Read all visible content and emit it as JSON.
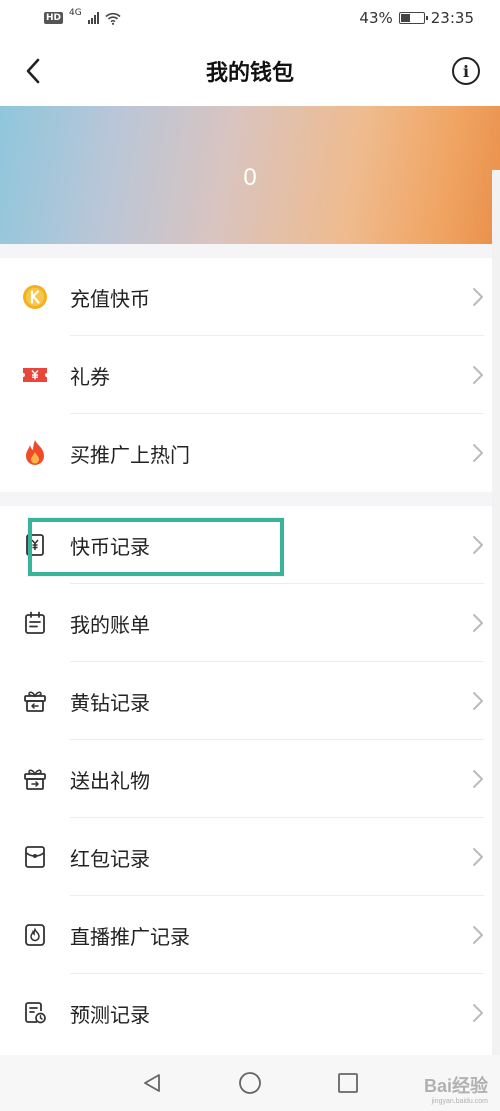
{
  "status_bar": {
    "hd": "HD",
    "net": "4G",
    "battery": "43%",
    "time": "23:35",
    "battery_level": 0.43
  },
  "header": {
    "title": "我的钱包",
    "back_icon": "chevron-left-icon",
    "info_icon": "info-icon",
    "info_glyph": "i"
  },
  "banner": {
    "value": "0"
  },
  "section1": [
    {
      "label": "充值快币",
      "icon": "k-coin-icon"
    },
    {
      "label": "礼券",
      "icon": "coupon-icon"
    },
    {
      "label": "买推广上热门",
      "icon": "flame-icon"
    }
  ],
  "section2": [
    {
      "label": "快币记录",
      "icon": "coin-record-icon"
    },
    {
      "label": "我的账单",
      "icon": "calendar-bill-icon"
    },
    {
      "label": "黄钻记录",
      "icon": "gift-in-icon"
    },
    {
      "label": "送出礼物",
      "icon": "gift-out-icon"
    },
    {
      "label": "红包记录",
      "icon": "red-envelope-icon"
    },
    {
      "label": "直播推广记录",
      "icon": "live-promo-icon"
    },
    {
      "label": "预测记录",
      "icon": "prediction-icon"
    }
  ],
  "colors": {
    "highlight": "#3bb39a",
    "coin": "#f5b021",
    "coupon": "#e8463a",
    "flame": "#ef4b2b"
  },
  "watermark": {
    "text": "Bai经验",
    "sub": "jingyan.baidu.com"
  }
}
